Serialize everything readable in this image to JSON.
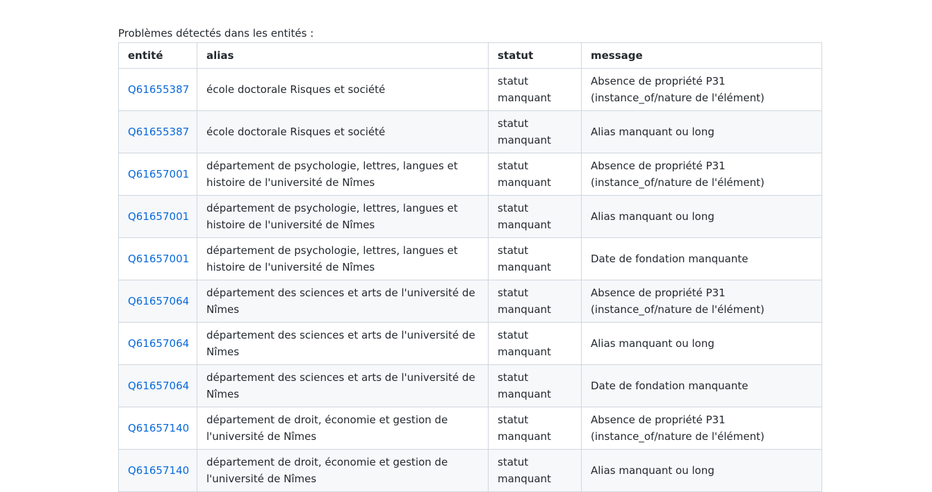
{
  "intro_text": "Problèmes détectés dans les entités :",
  "table": {
    "headers": {
      "entity": "entité",
      "alias": "alias",
      "status": "statut",
      "message": "message"
    },
    "rows": [
      {
        "entity": "Q61655387",
        "alias": "école doctorale Risques et société",
        "status": "statut manquant",
        "message": "Absence de propriété P31 (instance_of/nature de l'élément)"
      },
      {
        "entity": "Q61655387",
        "alias": "école doctorale Risques et société",
        "status": "statut manquant",
        "message": "Alias manquant ou long"
      },
      {
        "entity": "Q61657001",
        "alias": "département de psychologie, lettres, langues et histoire de l'université de Nîmes",
        "status": "statut manquant",
        "message": "Absence de propriété P31 (instance_of/nature de l'élément)"
      },
      {
        "entity": "Q61657001",
        "alias": "département de psychologie, lettres, langues et histoire de l'université de Nîmes",
        "status": "statut manquant",
        "message": "Alias manquant ou long"
      },
      {
        "entity": "Q61657001",
        "alias": "département de psychologie, lettres, langues et histoire de l'université de Nîmes",
        "status": "statut manquant",
        "message": "Date de fondation manquante"
      },
      {
        "entity": "Q61657064",
        "alias": "département des sciences et arts de l'université de Nîmes",
        "status": "statut manquant",
        "message": "Absence de propriété P31 (instance_of/nature de l'élément)"
      },
      {
        "entity": "Q61657064",
        "alias": "département des sciences et arts de l'université de Nîmes",
        "status": "statut manquant",
        "message": "Alias manquant ou long"
      },
      {
        "entity": "Q61657064",
        "alias": "département des sciences et arts de l'université de Nîmes",
        "status": "statut manquant",
        "message": "Date de fondation manquante"
      },
      {
        "entity": "Q61657140",
        "alias": "département de droit, économie et gestion de l'université de Nîmes",
        "status": "statut manquant",
        "message": "Absence de propriété P31 (instance_of/nature de l'élément)"
      },
      {
        "entity": "Q61657140",
        "alias": "département de droit, économie et gestion de l'université de Nîmes",
        "status": "statut manquant",
        "message": "Alias manquant ou long"
      }
    ]
  },
  "colors": {
    "link": "#0969da",
    "border": "#d0d7de",
    "stripe": "#f6f8fa",
    "text": "#24292f"
  }
}
